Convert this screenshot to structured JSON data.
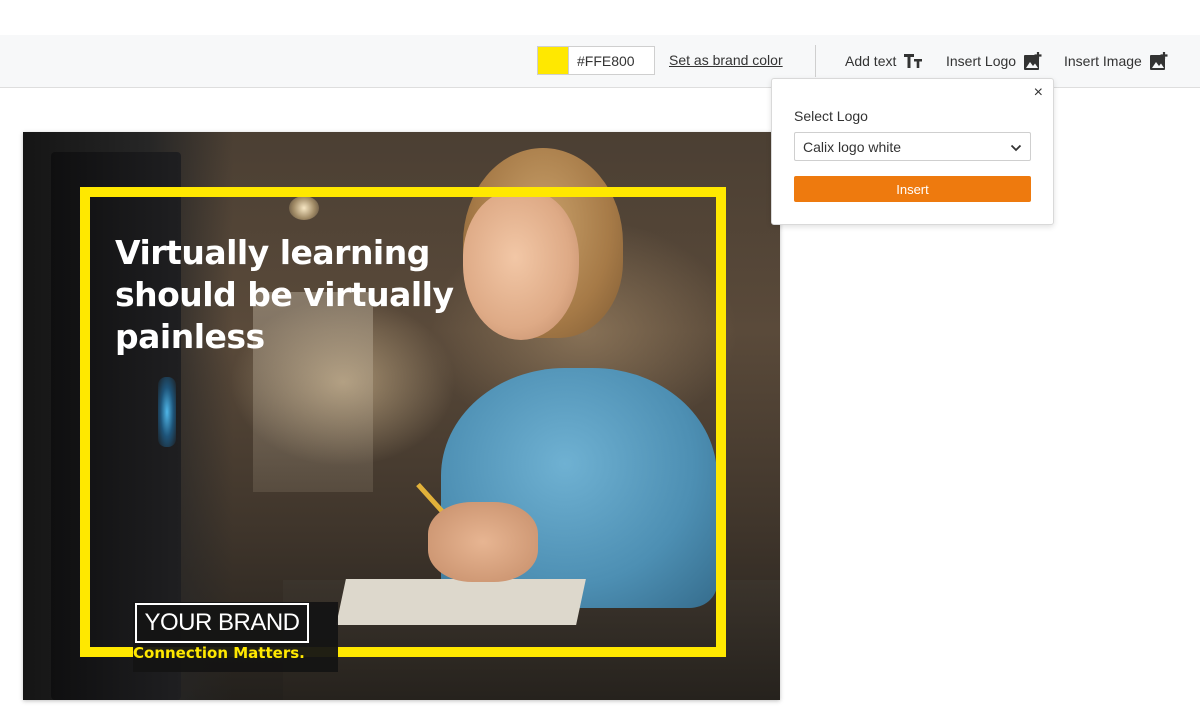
{
  "toolbar": {
    "brand_color": "#FFE800",
    "hex_value": "#FFE800",
    "set_brand_label": "Set as brand color",
    "add_text_label": "Add text",
    "insert_logo_label": "Insert Logo",
    "insert_image_label": "Insert Image"
  },
  "popup": {
    "close_symbol": "×",
    "select_label": "Select Logo",
    "selected_option": "Calix logo white",
    "insert_button": "Insert",
    "button_color": "#EE7A0E"
  },
  "canvas": {
    "headline": "Virtually learning should be virtually painless",
    "brand_text": "YOUR BRAND",
    "tagline": "Connection Matters.",
    "frame_color": "#FFE800"
  }
}
